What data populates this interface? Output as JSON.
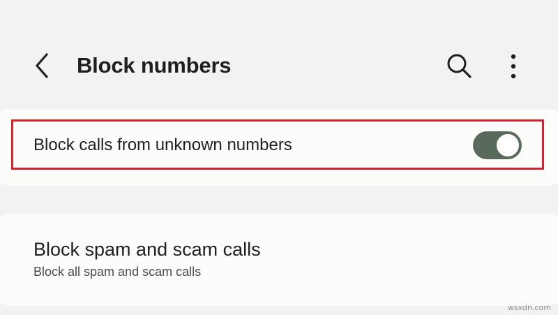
{
  "header": {
    "title": "Block numbers",
    "back_icon": "chevron-left-icon",
    "search_icon": "search-icon",
    "more_icon": "more-vertical-icon"
  },
  "settings": [
    {
      "label": "Block calls from unknown numbers",
      "toggle_on": true,
      "highlighted": true,
      "highlight_color": "#d2232c"
    },
    {
      "title": "Block spam and scam calls",
      "subtitle": "Block all spam and scam calls"
    }
  ],
  "colors": {
    "background": "#f2f2f0",
    "card": "#fcfcfb",
    "toggle_on": "#5a6a5a"
  },
  "watermark": "wsxdn.com"
}
